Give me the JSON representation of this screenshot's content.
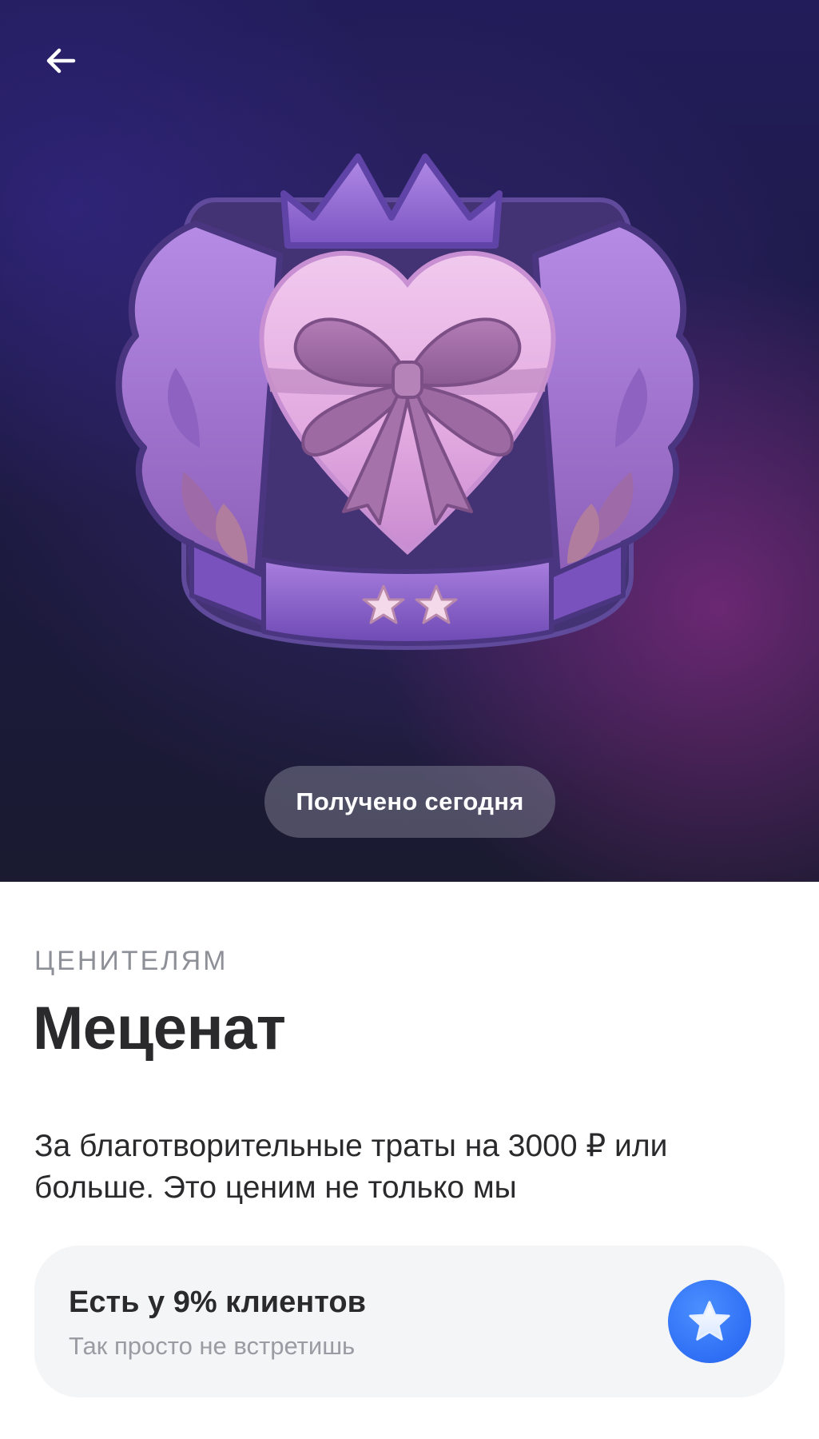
{
  "header": {
    "back_icon": "arrow-left-icon"
  },
  "hero": {
    "emblem": "heart-gift-crest-emblem",
    "stars_count": 2,
    "status_pill": "Получено сегодня"
  },
  "achievement": {
    "category": "ЦЕНИТЕЛЯМ",
    "title": "Меценат",
    "description": "За благотворительные траты на 3000 ₽ или больше. Это ценим не только мы"
  },
  "rarity": {
    "title": "Есть у 9% клиентов",
    "subtitle": "Так просто не встретишь",
    "icon": "star-icon",
    "icon_color": "#2f6ff5"
  },
  "colors": {
    "hero_bg": "#1d1a45",
    "text_primary": "#2a2a2c",
    "text_secondary": "#8e9097",
    "card_bg": "#f4f5f7"
  }
}
